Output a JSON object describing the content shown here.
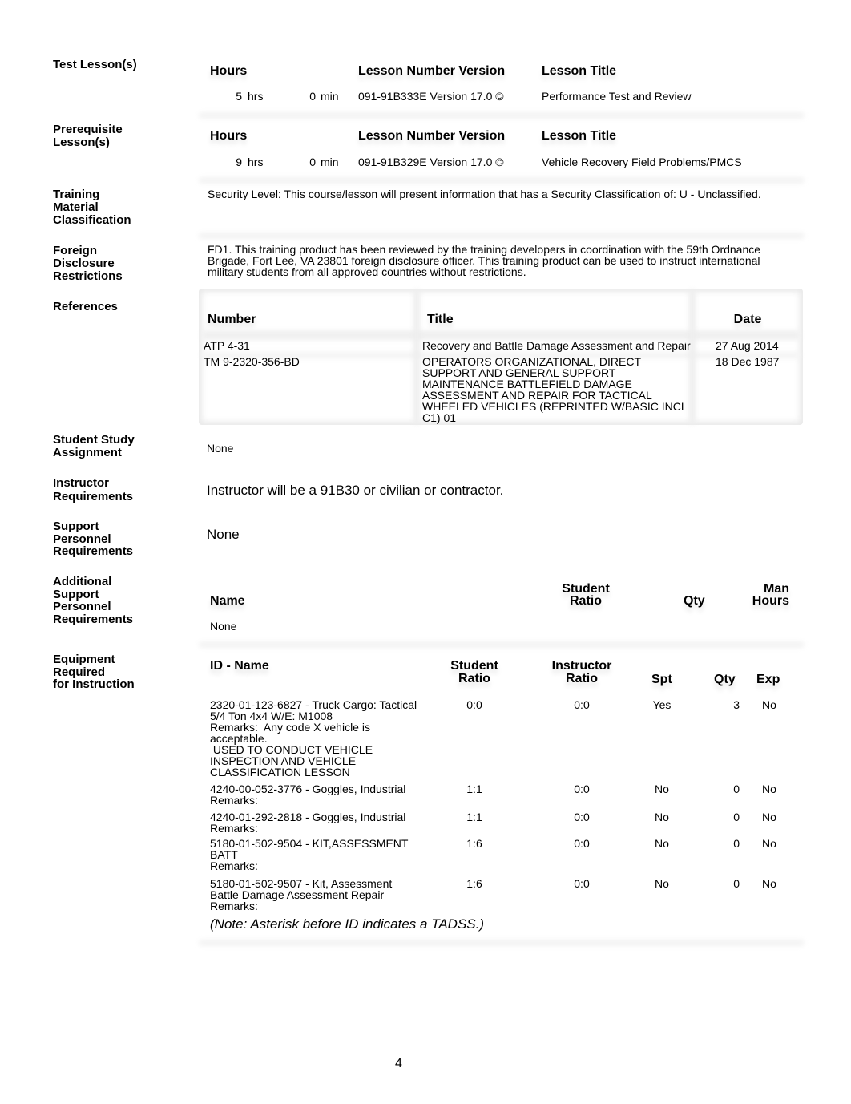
{
  "test_lessons": {
    "label": "Test Lesson(s)",
    "headers": {
      "hours": "Hours",
      "lesson_number_version": "Lesson Number Version",
      "lesson_title": "Lesson Title"
    },
    "rows": [
      {
        "hours": "5",
        "hrs_unit": "hrs",
        "minutes": "0",
        "min_unit": "min",
        "lesson_number_version": "091-91B333E Version 17.0 ©",
        "lesson_title": "Performance Test and Review"
      }
    ]
  },
  "prerequisite_lessons": {
    "label_line1": "Prerequisite",
    "label_line2": "Lesson(s)",
    "headers": {
      "hours": "Hours",
      "lesson_number_version": "Lesson Number Version",
      "lesson_title": "Lesson Title"
    },
    "rows": [
      {
        "hours": "9",
        "hrs_unit": "hrs",
        "minutes": "0",
        "min_unit": "min",
        "lesson_number_version": "091-91B329E Version 17.0 ©",
        "lesson_title": "Vehicle Recovery Field Problems/PMCS"
      }
    ]
  },
  "training_material_classification": {
    "label_lines": [
      "Training",
      "Material",
      "Classification"
    ],
    "text": "Security Level: This course/lesson will present information that has a Security Classification of: U - Unclassified."
  },
  "foreign_disclosure": {
    "label_lines": [
      "Foreign",
      "Disclosure",
      "Restrictions"
    ],
    "text_lines": [
      "FD1. This training product has been reviewed by the training developers in coordination with the 59th Ordnance",
      "Brigade, Fort Lee, VA 23801 foreign disclosure officer.   This training product can be used to instruct international",
      "military students from all approved countries without restrictions."
    ]
  },
  "references": {
    "label": "References",
    "headers": {
      "number": "Number",
      "title": "Title",
      "date": "Date"
    },
    "rows": [
      {
        "number": "ATP 4-31",
        "title_lines": [
          "Recovery and Battle Damage Assessment and Repair"
        ],
        "date": "27 Aug 2014"
      },
      {
        "number": "TM 9-2320-356-BD",
        "title_lines": [
          "OPERATORS ORGANIZATIONAL, DIRECT",
          "SUPPORT AND GENERAL SUPPORT",
          "MAINTENANCE BATTLEFIELD DAMAGE",
          "ASSESSMENT AND REPAIR FOR TACTICAL",
          "WHEELED VEHICLES (REPRINTED W/BASIC INCL",
          "C1) 01"
        ],
        "date": "18 Dec 1987"
      }
    ]
  },
  "student_study_assignment": {
    "label_lines": [
      "Student Study",
      "Assignment"
    ],
    "text": "None"
  },
  "instructor_requirements": {
    "label_lines": [
      "Instructor",
      "Requirements"
    ],
    "text": "Instructor will be a 91B30 or civilian or contractor."
  },
  "support_personnel_requirements": {
    "label_lines": [
      "Support",
      "Personnel",
      "Requirements"
    ],
    "text": "None"
  },
  "additional_support_personnel": {
    "label_lines": [
      "Additional",
      "Support",
      "Personnel",
      "Requirements"
    ],
    "headers": {
      "name": "Name",
      "student_ratio_line1": "Student",
      "student_ratio_line2": "Ratio",
      "qty": "Qty",
      "man_hours_line1": "Man",
      "man_hours_line2": "Hours"
    },
    "empty_text": "None"
  },
  "equipment": {
    "label_lines": [
      "Equipment",
      "Required",
      "for Instruction"
    ],
    "headers": {
      "id_name": "ID - Name",
      "student_ratio_line1": "Student",
      "student_ratio_line2": "Ratio",
      "instructor_ratio_line1": "Instructor",
      "instructor_ratio_line2": "Ratio",
      "spt": "Spt",
      "qty": "Qty",
      "exp": "Exp"
    },
    "rows": [
      {
        "lines": [
          "2320-01-123-6827 - Truck Cargo: Tactical",
          "5/4 Ton 4x4 W/E: M1008",
          "Remarks:  Any code X vehicle is",
          "acceptable.",
          " USED TO CONDUCT VEHICLE",
          "INSPECTION AND VEHICLE",
          "CLASSIFICATION LESSON"
        ],
        "student_ratio": "0:0",
        "instructor_ratio": "0:0",
        "spt": "Yes",
        "qty": "3",
        "exp": "No"
      },
      {
        "lines": [
          "4240-00-052-3776 - Goggles, Industrial",
          "Remarks:"
        ],
        "student_ratio": "1:1",
        "instructor_ratio": "0:0",
        "spt": "No",
        "qty": "0",
        "exp": "No"
      },
      {
        "lines": [
          "4240-01-292-2818 - Goggles, Industrial",
          "Remarks:"
        ],
        "student_ratio": "1:1",
        "instructor_ratio": "0:0",
        "spt": "No",
        "qty": "0",
        "exp": "No"
      },
      {
        "lines": [
          "5180-01-502-9504 - KIT,ASSESSMENT",
          "BATT",
          "Remarks:"
        ],
        "student_ratio": "1:6",
        "instructor_ratio": "0:0",
        "spt": "No",
        "qty": "0",
        "exp": "No"
      },
      {
        "lines": [
          "5180-01-502-9507 - Kit, Assessment",
          "Battle Damage Assessment Repair",
          "Remarks:"
        ],
        "student_ratio": "1:6",
        "instructor_ratio": "0:0",
        "spt": "No",
        "qty": "0",
        "exp": "No"
      }
    ],
    "note": "(Note: Asterisk before ID indicates a TADSS.)"
  },
  "page_number": "4"
}
